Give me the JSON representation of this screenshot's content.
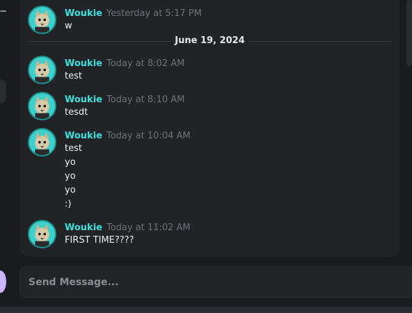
{
  "messages": [
    {
      "author": "Woukie",
      "time": "Yesterday at 5:17 PM",
      "lines": [
        "w"
      ]
    },
    {
      "author": "Woukie",
      "time": "Today at 8:02 AM",
      "lines": [
        "test"
      ]
    },
    {
      "author": "Woukie",
      "time": "Today at 8:10 AM",
      "lines": [
        "tesdt"
      ]
    },
    {
      "author": "Woukie",
      "time": "Today at 10:04 AM",
      "lines": [
        "test",
        "yo",
        "yo",
        "yo",
        ":)"
      ]
    },
    {
      "author": "Woukie",
      "time": "Today at 11:02 AM",
      "lines": [
        "FIRST TIME????"
      ]
    }
  ],
  "date_separator": "June 19, 2024",
  "composer": {
    "placeholder": "Send Message..."
  },
  "colors": {
    "author": "#3ee0dc",
    "timestamp": "#6f7078",
    "avatar_bg": "#3fd0c9",
    "accent_orb": "#c9b6ff"
  },
  "icons": {
    "avatar": "cat-avatar-icon"
  }
}
